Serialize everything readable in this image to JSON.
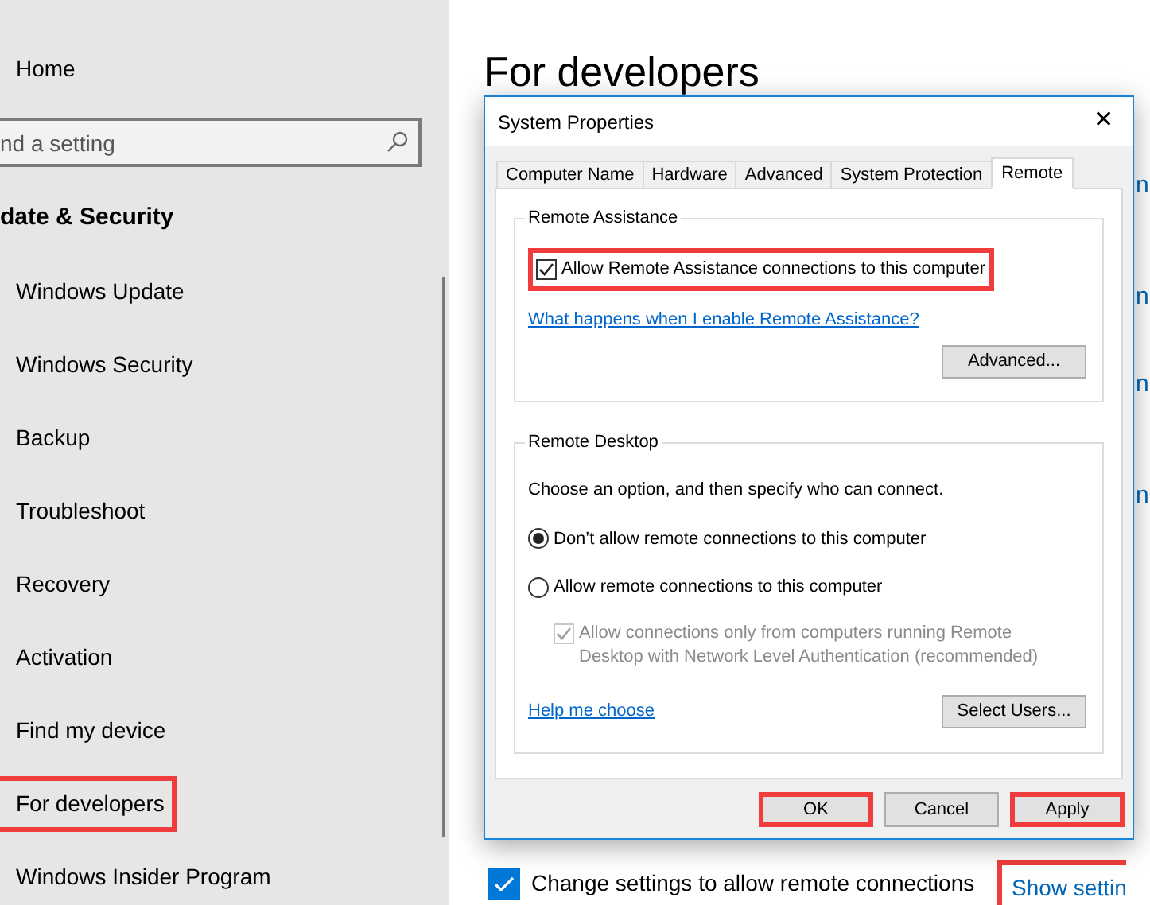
{
  "sidebar": {
    "home": "Home",
    "search": {
      "placeholder": "nd a setting"
    },
    "section_title": "date & Security",
    "items": [
      {
        "label": "Windows Update",
        "highlighted": false
      },
      {
        "label": "Windows Security",
        "highlighted": false
      },
      {
        "label": "Backup",
        "highlighted": false
      },
      {
        "label": "Troubleshoot",
        "highlighted": false
      },
      {
        "label": "Recovery",
        "highlighted": false
      },
      {
        "label": "Activation",
        "highlighted": false
      },
      {
        "label": "Find my device",
        "highlighted": false
      },
      {
        "label": "For developers",
        "highlighted": true
      },
      {
        "label": "Windows Insider Program",
        "highlighted": false
      }
    ]
  },
  "page": {
    "title": "For developers",
    "link_fragments": [
      "n",
      "n",
      "n",
      "n"
    ],
    "remote_option": {
      "label": "Change settings to allow remote connections",
      "checked": true
    },
    "show_settings": {
      "label": "Show settin",
      "highlighted": true
    }
  },
  "dialog": {
    "title": "System Properties",
    "close": "✕",
    "tabs": [
      {
        "label": "Computer Name",
        "selected": false
      },
      {
        "label": "Hardware",
        "selected": false
      },
      {
        "label": "Advanced",
        "selected": false
      },
      {
        "label": "System Protection",
        "selected": false
      },
      {
        "label": "Remote",
        "selected": true
      }
    ],
    "remote_assistance": {
      "title": "Remote Assistance",
      "allow": {
        "label": "Allow Remote Assistance connections to this computer",
        "checked": true,
        "highlighted": true
      },
      "link": "What happens when I enable Remote Assistance?",
      "advanced_button": "Advanced..."
    },
    "remote_desktop": {
      "title": "Remote Desktop",
      "instruction": "Choose an option, and then specify who can connect.",
      "options": [
        {
          "label": "Don’t allow remote connections to this computer",
          "selected": true
        },
        {
          "label": "Allow remote connections to this computer",
          "selected": false
        }
      ],
      "nla": {
        "label": "Allow connections only from computers running Remote Desktop with Network Level Authentication (recommended)",
        "checked": true,
        "disabled": true
      },
      "help_link": "Help me choose",
      "select_users_button": "Select Users..."
    },
    "buttons": [
      {
        "label": "OK",
        "highlighted": true
      },
      {
        "label": "Cancel",
        "highlighted": false
      },
      {
        "label": "Apply",
        "highlighted": true
      }
    ]
  }
}
